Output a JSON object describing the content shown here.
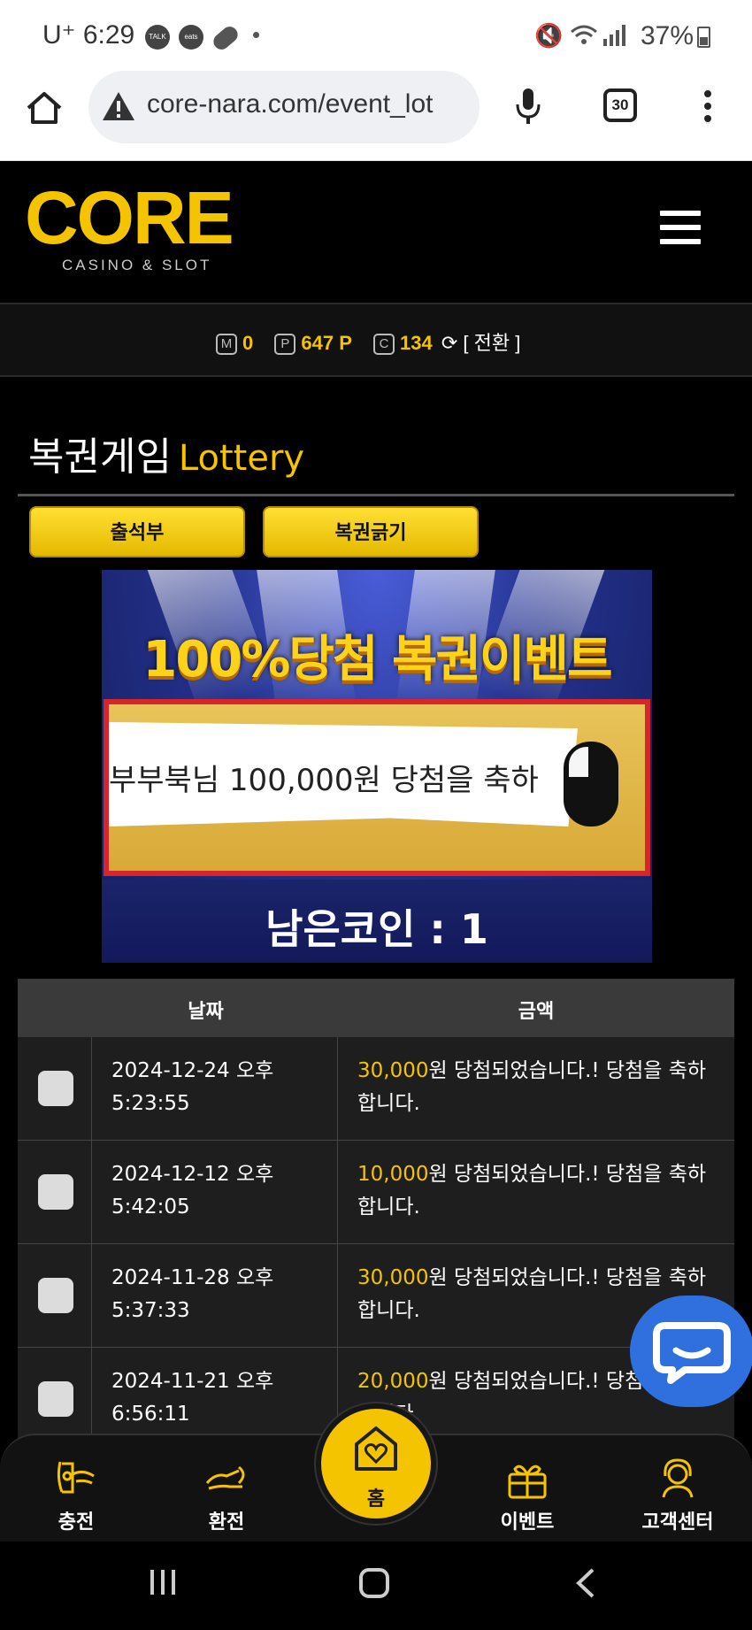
{
  "status_bar": {
    "time": "U⁺ 6:29",
    "app_icons": [
      "kakao-talk-icon",
      "coupang-eats-icon",
      "pill-icon"
    ],
    "app_icon_labels": [
      "TALK",
      "eats"
    ],
    "battery": "37%"
  },
  "browser": {
    "url": "core-nara.com/event_lot",
    "tab_count": "30"
  },
  "site": {
    "logo_word": "CORE",
    "logo_sub": "CASINO & SLOT"
  },
  "points": {
    "m_badge": "M",
    "m_value": "0",
    "p_badge": "P",
    "p_value": "647 P",
    "c_badge": "C",
    "c_value": "134",
    "swap_label": "[ 전환 ]"
  },
  "page": {
    "title_ko": "복권게임",
    "title_en": "Lottery",
    "btn_attendance": "출석부",
    "btn_scratch": "복권긁기"
  },
  "banner": {
    "headline": "100%당첨 복권이벤트",
    "scratch_message": "부부북님  100,000원 당첨을 축하",
    "remaining_coins": "남은코인 : 1"
  },
  "table": {
    "headers": {
      "date": "날짜",
      "amount": "금액"
    },
    "rows": [
      {
        "date_line1": "2024-12-24 오후",
        "date_line2": "5:23:55",
        "amount": "30,000",
        "text_rest": "원 당첨되었습니다.! 당첨을 축하합니다."
      },
      {
        "date_line1": "2024-12-12 오후",
        "date_line2": "5:42:05",
        "amount": "10,000",
        "text_rest": "원 당첨되었습니다.! 당첨을 축하합니다."
      },
      {
        "date_line1": "2024-11-28 오후",
        "date_line2": "5:37:33",
        "amount": "30,000",
        "text_rest": "원 당첨되었습니다.! 당첨을 축하합니다."
      },
      {
        "date_line1": "2024-11-21 오후",
        "date_line2": "6:56:11",
        "amount": "20,000",
        "text_rest": "원 당첨되었습니다.! 당첨을 축하합니다."
      }
    ]
  },
  "bottom_nav": {
    "charge": "충전",
    "exchange": "환전",
    "home": "홈",
    "event": "이벤트",
    "support": "고객센터"
  },
  "colors": {
    "accent_yellow": "#f5c400",
    "chat_blue": "#2f6fde",
    "banner_red": "#d6262b"
  }
}
